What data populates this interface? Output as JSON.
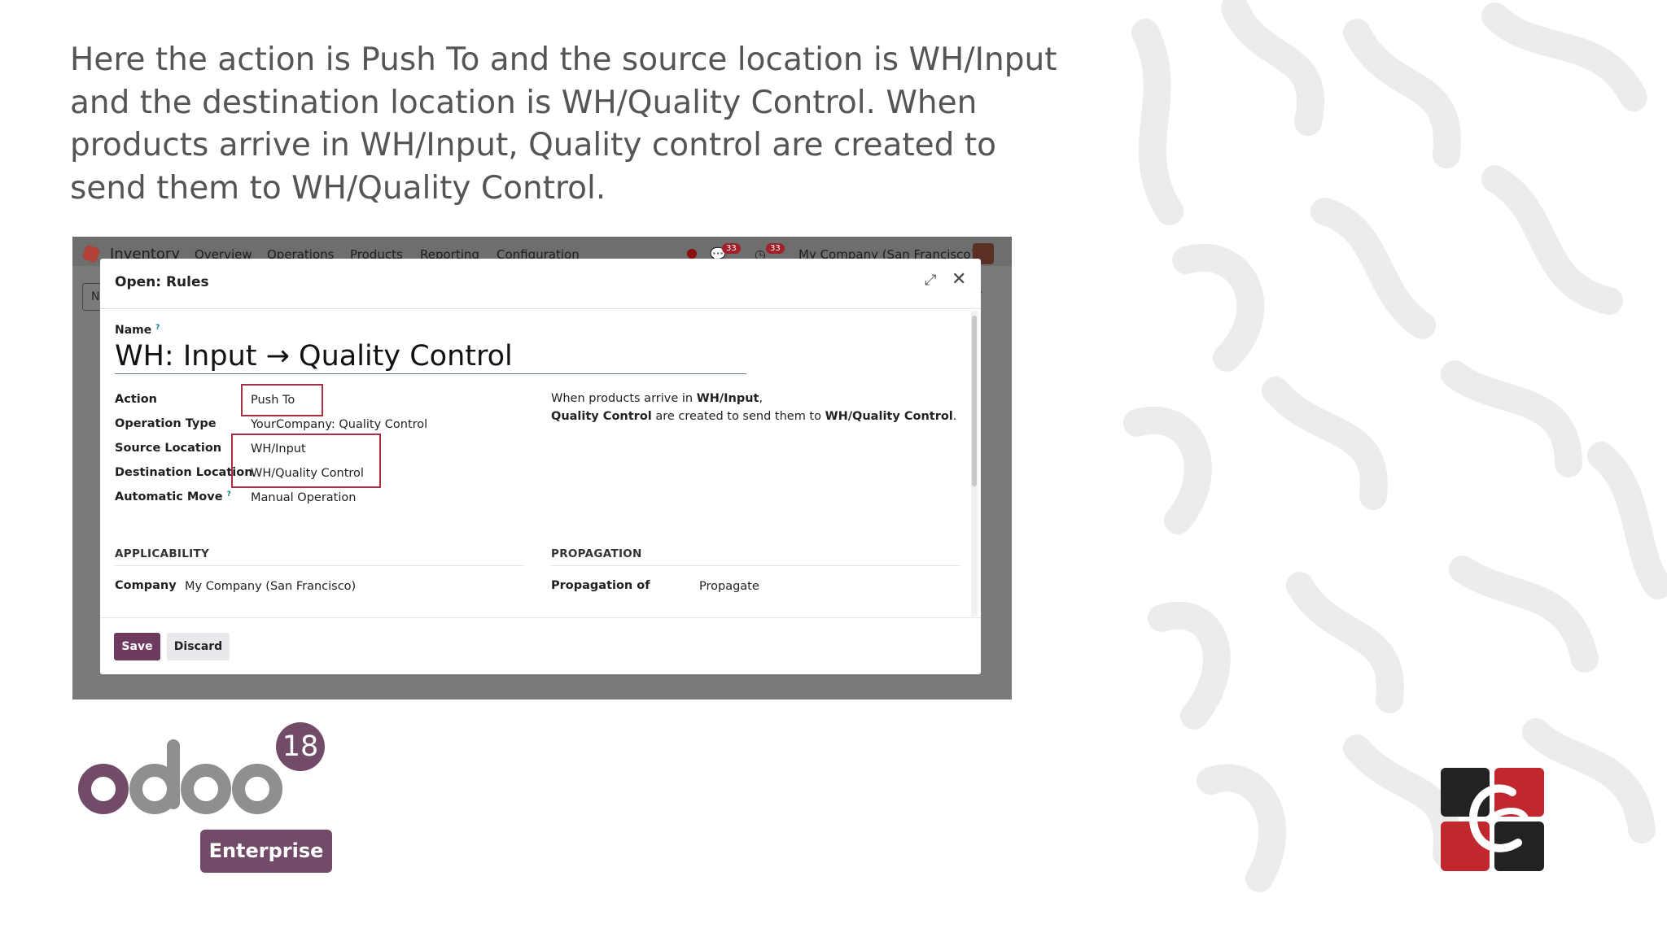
{
  "caption": "Here the action is Push To and the source location is WH/Input and the destination location is WH/Quality Control. When products arrive in WH/Input, Quality control are created to send them to WH/Quality Control.",
  "app": {
    "name": "Inventory",
    "menu": [
      "Overview",
      "Operations",
      "Products",
      "Reporting",
      "Configuration"
    ],
    "messages_count": "33",
    "activities_count": "33",
    "company": "My Company (San Francisco)",
    "bg_control": "N"
  },
  "modal": {
    "title": "Open: Rules",
    "name_label": "Name",
    "name_help": "?",
    "name_value": "WH: Input → Quality Control",
    "fields": {
      "action_label": "Action",
      "action_value": "Push To",
      "operation_type_label": "Operation Type",
      "operation_type_value": "YourCompany: Quality Control",
      "source_location_label": "Source Location",
      "source_location_value": "WH/Input",
      "destination_location_label": "Destination Location",
      "destination_location_value": "WH/Quality Control",
      "automatic_move_label": "Automatic Move",
      "automatic_move_help": "?",
      "automatic_move_value": "Manual Operation"
    },
    "info": {
      "line1_prefix": "When products arrive in ",
      "line1_bold": "WH/Input",
      "line1_suffix": ",",
      "line2_bold1": "Quality Control",
      "line2_mid": " are created to send them to ",
      "line2_bold2": "WH/Quality Control",
      "line2_suffix": "."
    },
    "sections": {
      "applicability": "APPLICABILITY",
      "propagation": "PROPAGATION",
      "company_label": "Company",
      "company_value": "My Company (San Francisco)",
      "propagation_of_label": "Propagation of",
      "propagation_of_value": "Propagate"
    },
    "buttons": {
      "save": "Save",
      "discard": "Discard"
    }
  },
  "branding": {
    "odoo_version": "18",
    "edition": "Enterprise",
    "odoo_color": "#714b67"
  },
  "colors": {
    "highlight_box": "#a93040",
    "primary_button": "#6e3a60"
  }
}
